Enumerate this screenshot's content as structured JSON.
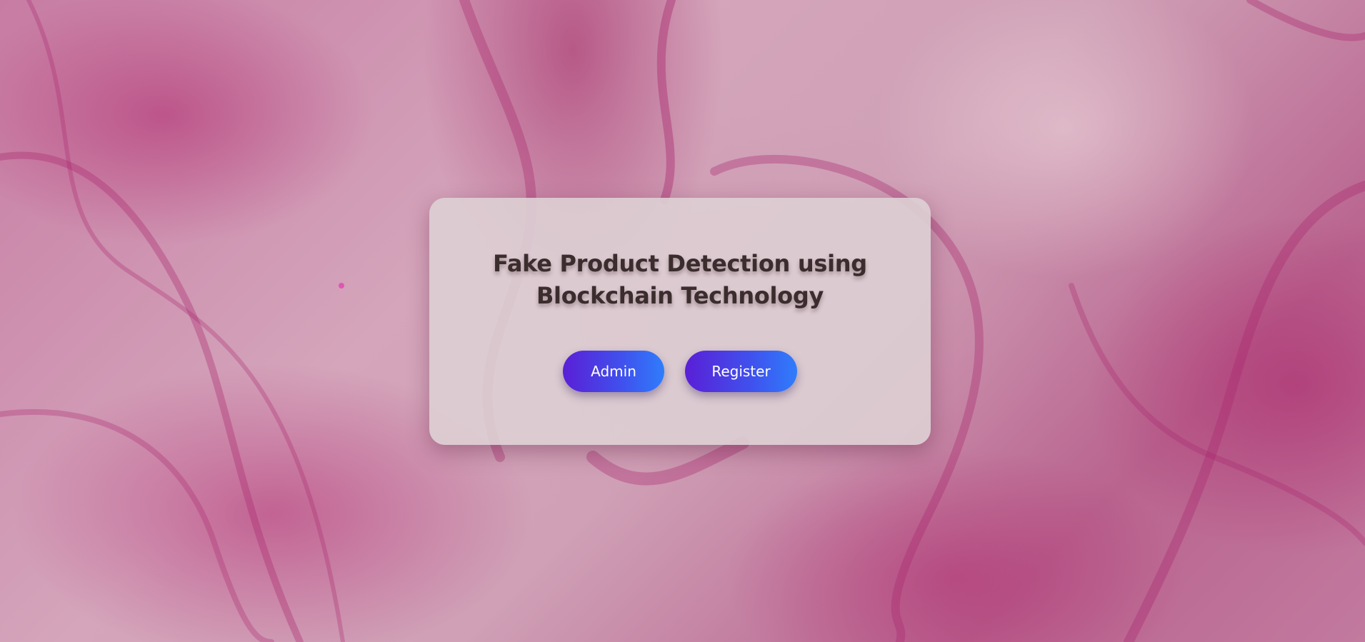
{
  "page": {
    "heading_line1": "Fake Product Detection using",
    "heading_line2": "Blockchain Technology"
  },
  "actions": {
    "admin_label": "Admin",
    "register_label": "Register"
  },
  "colors": {
    "button_gradient_start": "#5a1fd6",
    "button_gradient_end": "#2f7dfb",
    "heading": "#3b2c2e",
    "panel": "#dccecf",
    "background_accent": "#b9648f"
  }
}
